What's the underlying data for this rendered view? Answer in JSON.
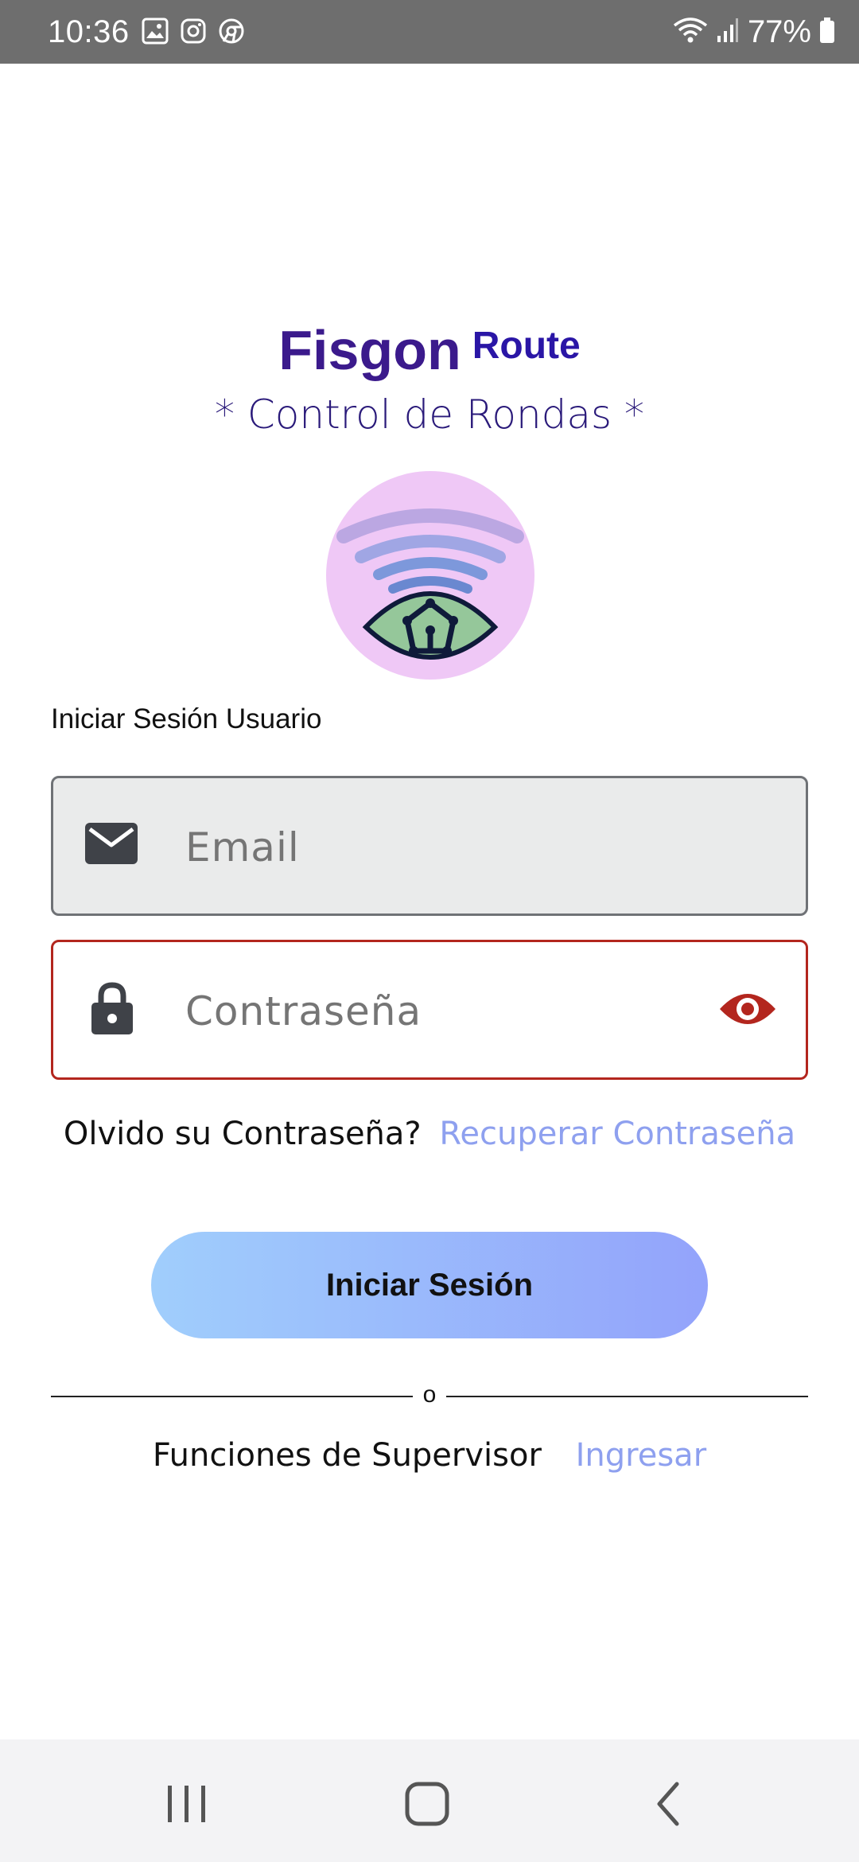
{
  "status_bar": {
    "time": "10:36",
    "battery": "77%"
  },
  "brand": {
    "name": "Fisgon",
    "suffix": "Route",
    "tagline": "* Control de Rondas *"
  },
  "login": {
    "section_label": "Iniciar Sesión Usuario",
    "email_placeholder": "Email",
    "password_placeholder": "Contraseña",
    "forgot_question": "Olvido su Contraseña?",
    "forgot_link": "Recuperar Contraseña",
    "submit_label": "Iniciar Sesión"
  },
  "divider": {
    "text": "o"
  },
  "supervisor": {
    "label": "Funciones de Supervisor",
    "link": "Ingresar"
  },
  "colors": {
    "brand": "#3b1a8c",
    "error": "#b3261e",
    "link": "#8ea0ef"
  }
}
